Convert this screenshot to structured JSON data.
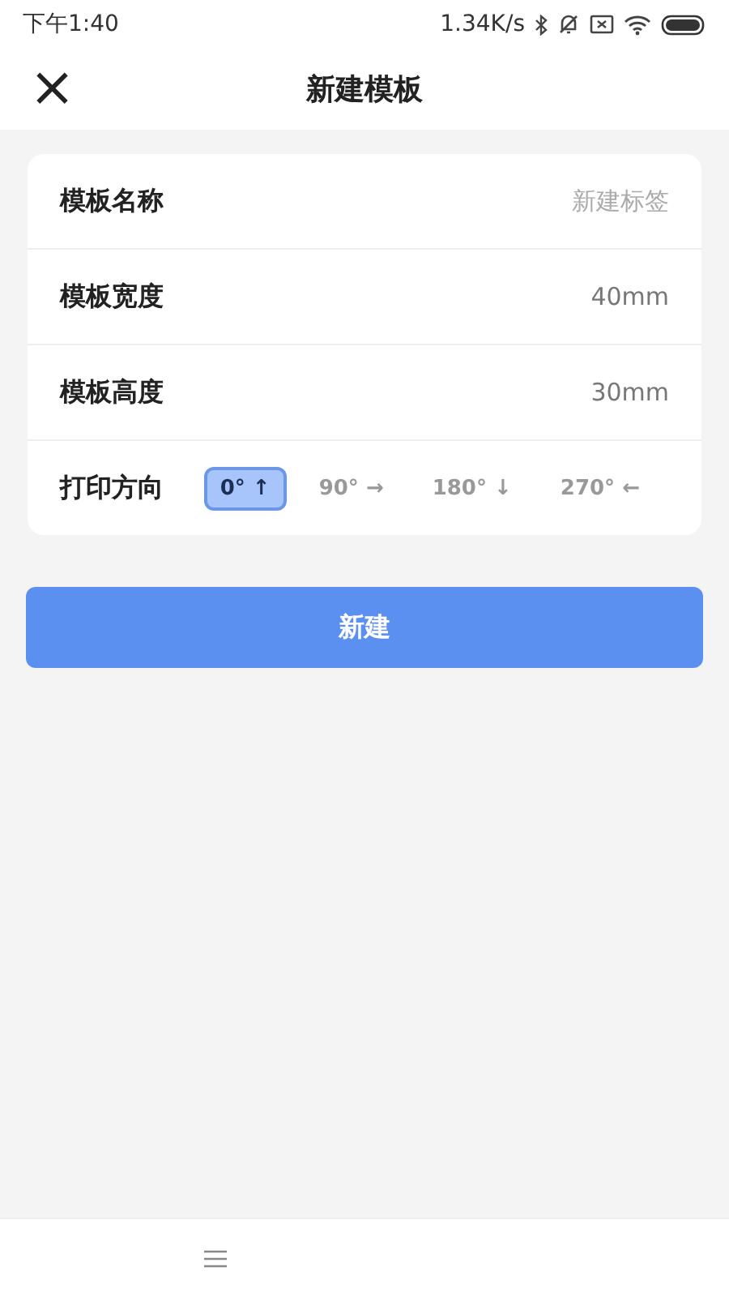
{
  "status_bar": {
    "time": "下午1:40",
    "speed": "1.34K/s"
  },
  "header": {
    "close": "×",
    "title": "新建模板"
  },
  "form": {
    "rows": [
      {
        "kind": "input",
        "label": "模板名称",
        "placeholder": "新建标签"
      },
      {
        "kind": "value",
        "label": "模板宽度",
        "value": "40mm"
      },
      {
        "kind": "value",
        "label": "模板高度",
        "value": "30mm"
      },
      {
        "kind": "orientation",
        "label": "打印方向",
        "options": [
          {
            "angle": "0°",
            "arrow": "↑",
            "selected": true
          },
          {
            "angle": "90°",
            "arrow": "→",
            "selected": false
          },
          {
            "angle": "180°",
            "arrow": "↓",
            "selected": false
          },
          {
            "angle": "270°",
            "arrow": "←",
            "selected": false
          }
        ]
      }
    ]
  },
  "create_button": "新建"
}
